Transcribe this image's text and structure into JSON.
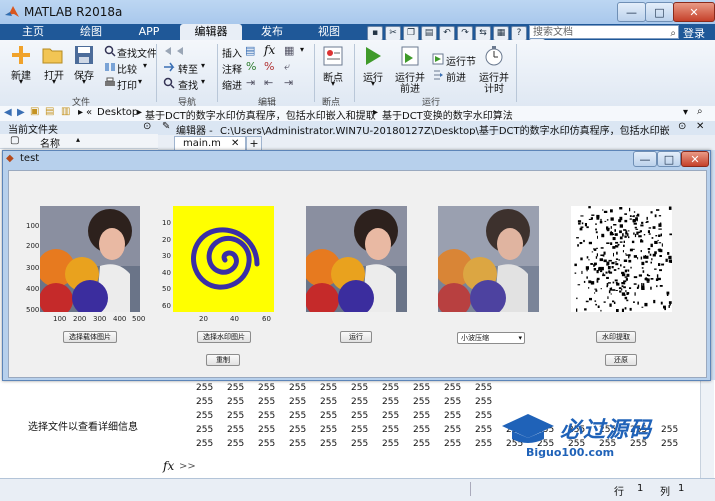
{
  "app": {
    "title": "MATLAB R2018a"
  },
  "tabs": [
    "主页",
    "绘图",
    "APP",
    "编辑器",
    "发布",
    "视图"
  ],
  "active_tab": "编辑器",
  "search": {
    "placeholder": "搜索文档"
  },
  "login": "登录",
  "ribbon": {
    "file": {
      "new": "新建",
      "open": "打开",
      "save": "保存",
      "find_files": "查找文件",
      "compare": "比较",
      "print": "打印",
      "group": "文件"
    },
    "nav": {
      "goto": "转至",
      "find": "查找",
      "group": "导航"
    },
    "edit": {
      "insert": "插入",
      "comment": "注释",
      "indent": "缩进",
      "fx": "fx",
      "group": "编辑"
    },
    "breakpoint": {
      "label": "断点",
      "group": "断点"
    },
    "run": {
      "run": "运行",
      "run_advance_1": "运行并",
      "run_advance_2": "前进",
      "run_section": "运行节",
      "advance": "前进",
      "run_time_1": "运行并",
      "run_time_2": "计时",
      "group": "运行"
    }
  },
  "address": {
    "path1": "Desktop",
    "path2": "基于DCT的数字水印仿真程序，包括水印嵌入和提取",
    "path3": "基于DCT变换的数字水印算法"
  },
  "left_panel": {
    "header": "当前文件夹",
    "column": "名称",
    "detail": "选择文件以查看详细信息"
  },
  "editor": {
    "header_prefix": "编辑器 -",
    "path": "C:\\Users\\Administrator.WIN7U-20180127Z\\Desktop\\基于DCT的数字水印仿真程序，包括水印嵌入和提取\\基",
    "tab": "main.m"
  },
  "figure": {
    "title": "test",
    "axes1": {
      "yticks": [
        "100",
        "200",
        "300",
        "400",
        "500"
      ],
      "xticks": [
        "100",
        "200",
        "300",
        "400",
        "500"
      ]
    },
    "axes2": {
      "yticks": [
        "10",
        "20",
        "30",
        "40",
        "50",
        "60"
      ],
      "xticks": [
        "20",
        "40",
        "60"
      ]
    },
    "buttons": {
      "select_carrier": "选择载体图片",
      "select_watermark": "选择水印图片",
      "reset": "重制",
      "run": "运行",
      "extract": "水印提取",
      "restore": "还原"
    },
    "dropdown": {
      "selected": "小波压缩"
    }
  },
  "cmd": {
    "value": "255",
    "prompt": ">>"
  },
  "status": {
    "row_label": "行",
    "row": "1",
    "col_label": "列",
    "col": "1"
  },
  "watermark": {
    "main": "必过源码",
    "sub": "Biguo100.com"
  },
  "colors": {
    "ribbon_blue": "#1f5898",
    "watermark_yellow": "#ffff00",
    "watermark_spiral": "#3a2ea6"
  }
}
